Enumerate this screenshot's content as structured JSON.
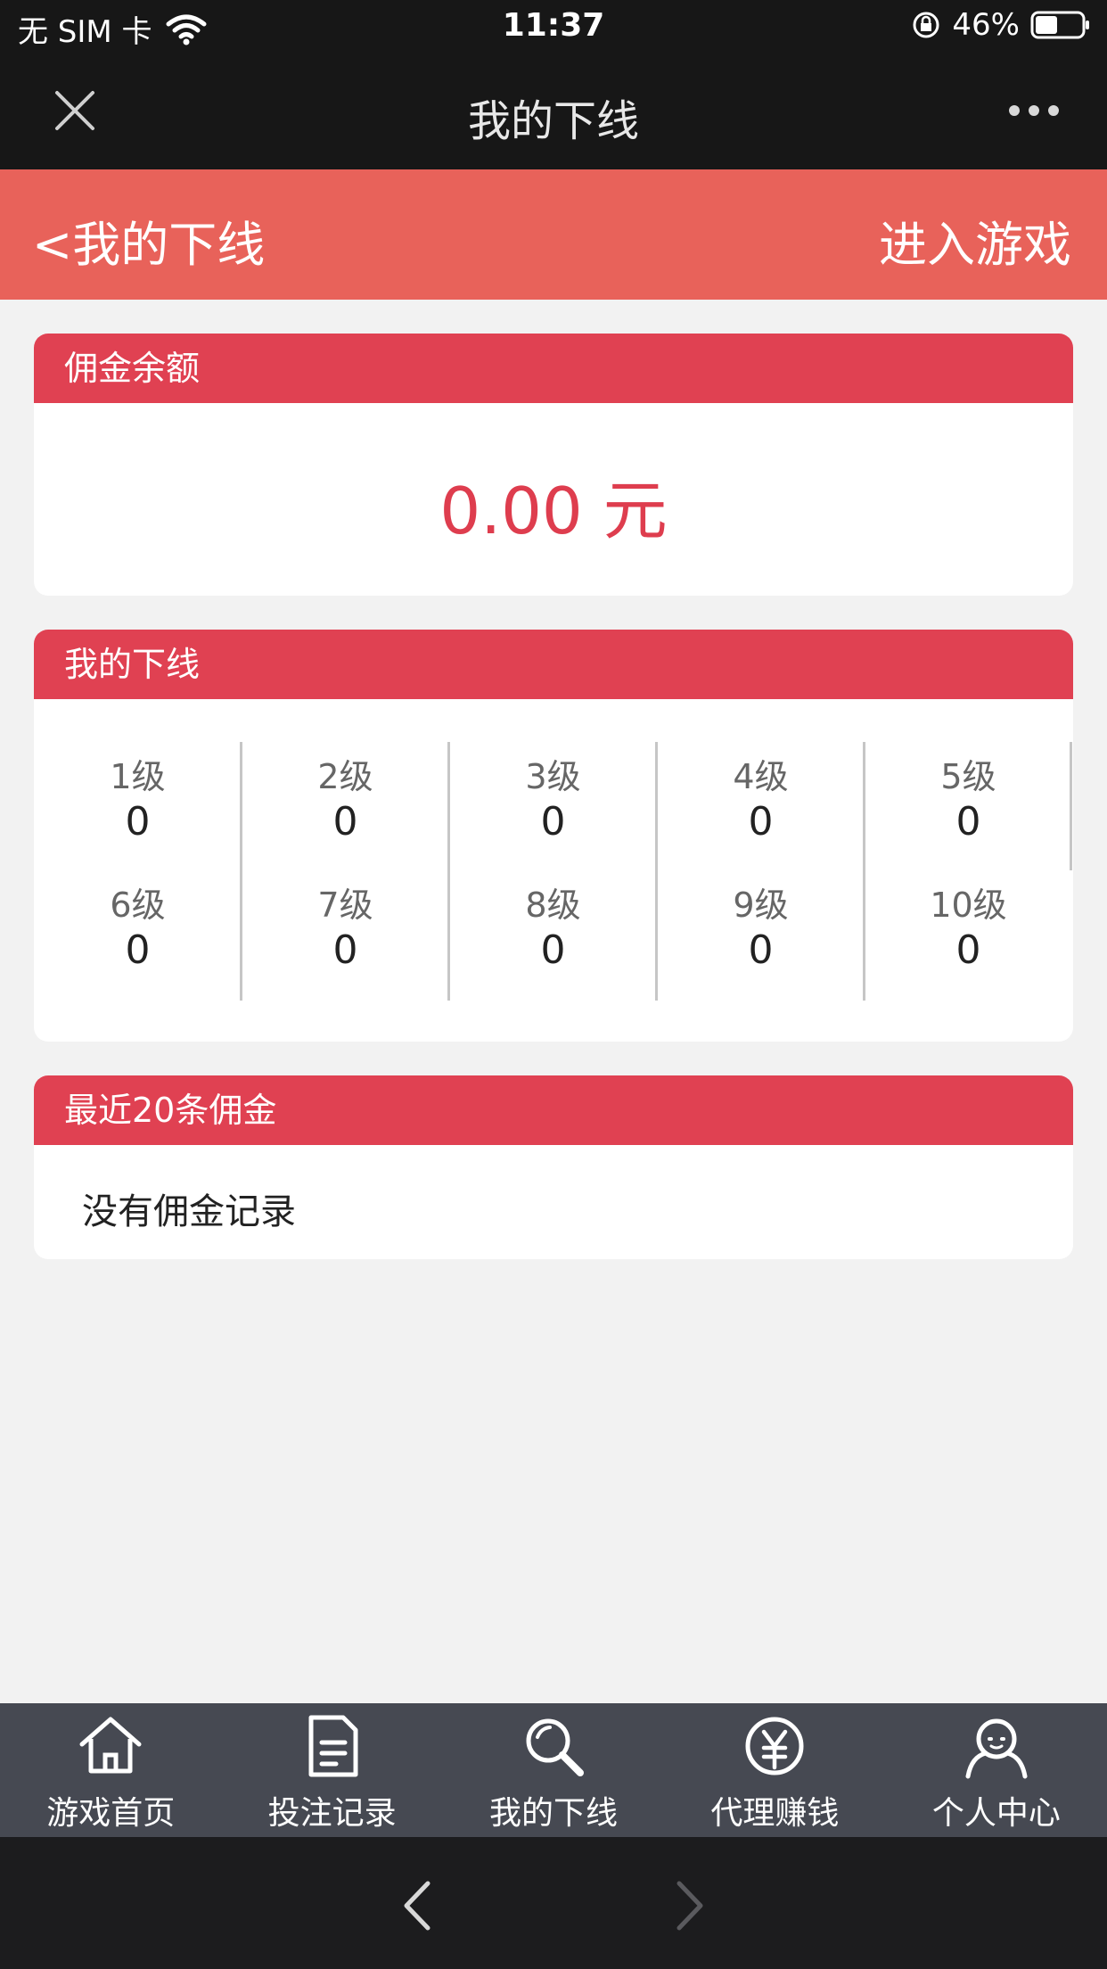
{
  "status_bar": {
    "carrier": "无 SIM 卡",
    "time": "11:37",
    "battery": "46%"
  },
  "wechat_nav": {
    "title": "我的下线"
  },
  "header": {
    "back_label": "<我的下线",
    "enter_game_label": "进入游戏"
  },
  "commission_balance": {
    "title": "佣金余额",
    "amount": "0.00 元"
  },
  "downline": {
    "title": "我的下线",
    "columns": [
      {
        "rows": [
          {
            "level": "1级",
            "count": "0"
          },
          {
            "level": "6级",
            "count": "0"
          }
        ]
      },
      {
        "rows": [
          {
            "level": "2级",
            "count": "0"
          },
          {
            "level": "7级",
            "count": "0"
          }
        ]
      },
      {
        "rows": [
          {
            "level": "3级",
            "count": "0"
          },
          {
            "level": "8级",
            "count": "0"
          }
        ]
      },
      {
        "rows": [
          {
            "level": "4级",
            "count": "0"
          },
          {
            "level": "9级",
            "count": "0"
          }
        ]
      },
      {
        "rows": [
          {
            "level": "5级",
            "count": "0"
          },
          {
            "level": "10级",
            "count": "0"
          }
        ]
      }
    ]
  },
  "recent_commissions": {
    "title": "最近20条佣金",
    "empty_text": "没有佣金记录"
  },
  "tabbar": {
    "items": [
      {
        "label": "游戏首页",
        "icon": "home-icon"
      },
      {
        "label": "投注记录",
        "icon": "document-icon"
      },
      {
        "label": "我的下线",
        "icon": "search-icon"
      },
      {
        "label": "代理赚钱",
        "icon": "yen-icon"
      },
      {
        "label": "个人中心",
        "icon": "user-icon"
      }
    ]
  }
}
